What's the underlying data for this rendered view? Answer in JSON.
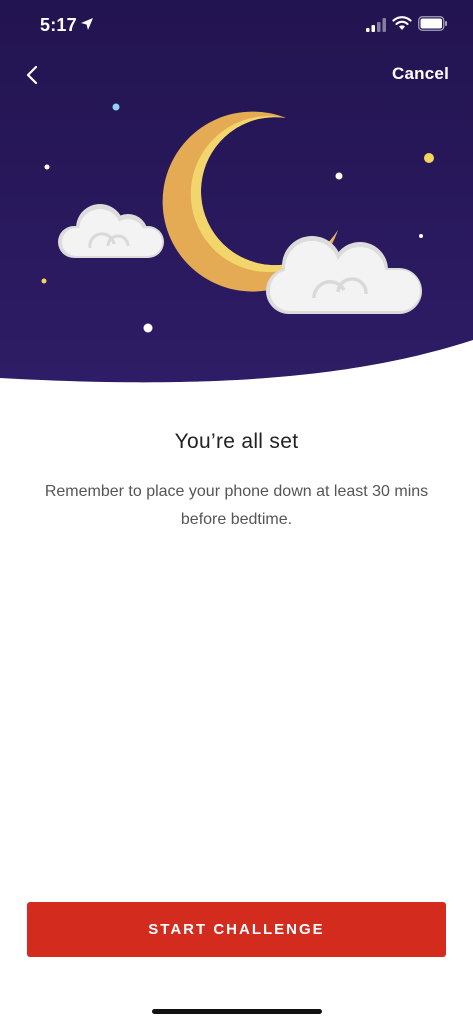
{
  "status_bar": {
    "time": "5:17"
  },
  "nav": {
    "back_icon": "chevron-left-icon",
    "cancel_label": "Cancel"
  },
  "hero": {
    "illustration": "moon-clouds-stars",
    "colors": {
      "sky": "#2a1a5e",
      "moon_front": "#f2d66b",
      "moon_back": "#e4ab54",
      "cloud": "#f2f2f2",
      "star_white": "#ffffff",
      "star_yellow": "#f4d35e",
      "star_blue": "#8fd3f4"
    }
  },
  "content": {
    "title": "You’re all set",
    "message": "Remember to place your phone down at least 30 mins before bedtime."
  },
  "actions": {
    "start_label": "START CHALLENGE",
    "accent_color": "#d42b1f"
  }
}
